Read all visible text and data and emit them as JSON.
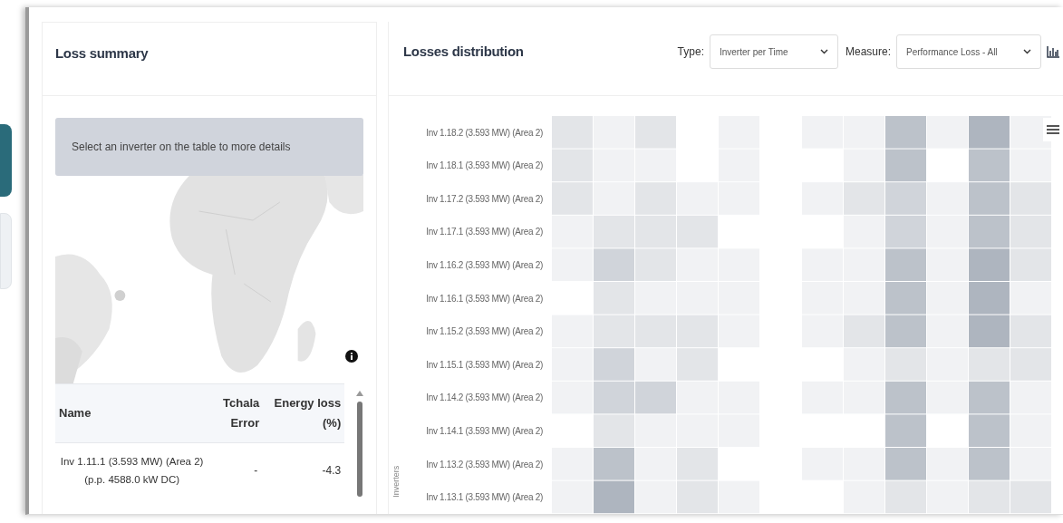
{
  "sidebar": {
    "tabs": [
      {
        "selected": true
      },
      {
        "selected": false
      }
    ]
  },
  "loss_summary": {
    "title": "Loss summary",
    "notice": "Select an inverter on the table to more details",
    "table": {
      "columns": [
        "Name",
        "Tchala Error",
        "Energy loss (%)"
      ],
      "rows": [
        {
          "name": "Inv 1.11.1 (3.593 MW) (Area 2) (p.p. 4588.0 kW DC)",
          "tchala_error": "-",
          "energy_loss": "-4.3"
        }
      ]
    }
  },
  "losses_distribution": {
    "title": "Losses distribution",
    "filters": [
      {
        "label": "Type:",
        "value": "Inverter per Time"
      },
      {
        "label": "Measure:",
        "value": "Performance Loss - All"
      }
    ],
    "y_axis_title": "Inverters",
    "rows": [
      "Inv 1.18.2 (3.593 MW) (Area 2)",
      "Inv 1.18.1 (3.593 MW) (Area 2)",
      "Inv 1.17.2 (3.593 MW) (Area 2)",
      "Inv 1.17.1 (3.593 MW) (Area 2)",
      "Inv 1.16.2 (3.593 MW) (Area 2)",
      "Inv 1.16.1 (3.593 MW) (Area 2)",
      "Inv 1.15.2 (3.593 MW) (Area 2)",
      "Inv 1.15.1 (3.593 MW) (Area 2)",
      "Inv 1.14.2 (3.593 MW) (Area 2)",
      "Inv 1.14.1 (3.593 MW) (Area 2)",
      "Inv 1.13.2 (3.593 MW) (Area 2)",
      "Inv 1.13.1 (3.593 MW) (Area 2)"
    ]
  }
}
